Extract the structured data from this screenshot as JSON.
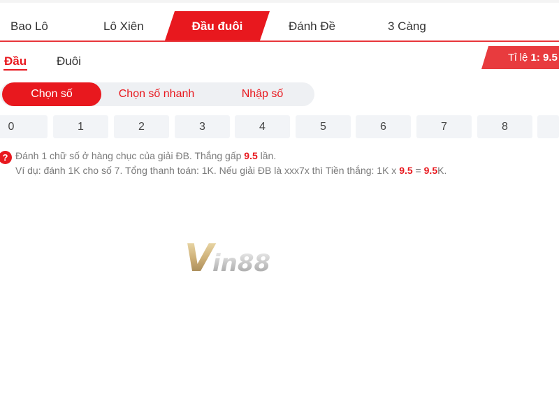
{
  "main_tabs": [
    {
      "label": "Bao Lô"
    },
    {
      "label": "Lô Xiên"
    },
    {
      "label": "Đầu đuôi"
    },
    {
      "label": "Đánh Đề"
    },
    {
      "label": "3 Càng"
    }
  ],
  "active_main_tab": "Đầu đuôi",
  "sub_tabs": [
    {
      "label": "Đầu"
    },
    {
      "label": "Đuôi"
    }
  ],
  "active_sub_tab": "Đầu",
  "ratio": {
    "label": "Tỉ lệ",
    "value": "1: 9.5"
  },
  "selection_modes": [
    {
      "label": "Chọn số"
    },
    {
      "label": "Chọn số nhanh"
    },
    {
      "label": "Nhập số"
    }
  ],
  "active_selection_mode": "Chọn số",
  "digits": [
    "0",
    "1",
    "2",
    "3",
    "4",
    "5",
    "6",
    "7",
    "8",
    ""
  ],
  "info": {
    "icon": "question-icon",
    "line1": {
      "text_before": "Đánh 1 chữ số ở hàng chục của giải ĐB. Thắng gấp ",
      "highlight": "9.5",
      "text_after": " lần."
    },
    "line2": {
      "text_before": "Ví dụ: đánh 1K cho số 7. Tổng thanh toán: 1K. Nếu giải ĐB là xxx7x thì Tiền thắng: 1K x ",
      "highlight1": "9.5",
      "middle": " = ",
      "highlight2": "9.5",
      "text_after": "K."
    }
  },
  "watermark": {
    "text": "Vin88"
  },
  "colors": {
    "accent": "#e8181e",
    "badge": "#e83b3e",
    "control_bg": "#eef0f3",
    "digit_bg": "#f2f4f7",
    "info_text": "#7a7a7a"
  }
}
